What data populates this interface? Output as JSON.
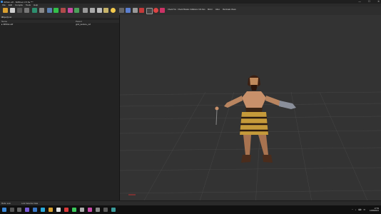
{
  "window": {
    "title": "3DSlot.vdf - SMDtool 3.5.5a ***"
  },
  "window_controls": {
    "minimize": "—",
    "maximize": "☐",
    "close": "✕"
  },
  "menu": [
    "File",
    "Edit",
    "Compile",
    "Tools",
    "Help"
  ],
  "toolbar": {
    "text_buttons": [
      "Check Tex",
      "Check Breaks",
      "Collisions",
      "Ctrl Axis",
      "Mirror",
      "Hi/Lo",
      "Illuminate Views"
    ]
  },
  "left_panel": {
    "header": "Object List",
    "header_buttons": "✕ ▢",
    "columns": {
      "name": "Name",
      "parent": "Parent"
    },
    "rows": [
      {
        "name": "▸ 3DSlot.vdf",
        "parent": "gnd_texture_ref"
      }
    ]
  },
  "viewport": {
    "status": "Z:0  Dir:Pos:Ang / 3DSlot/Vertex/X,Y,Z Cursor/Axis/Snap | Angle:X=0.5 | FPS:60.2 | Track:Perspective/3DSlot/X,Y,Z3,Z2 View/Obj/7 x"
  },
  "statusbar": {
    "left": "Mode: auto",
    "right": "Lock Selection Data"
  },
  "taskbar": {
    "tray": [
      "^",
      "♪",
      "⌨",
      "✉"
    ],
    "time": "17:53",
    "date": "12/08/2021"
  },
  "colors": {
    "accent": "#3a88d8",
    "viewport_bg": "#333333",
    "panel_bg": "#232323"
  }
}
